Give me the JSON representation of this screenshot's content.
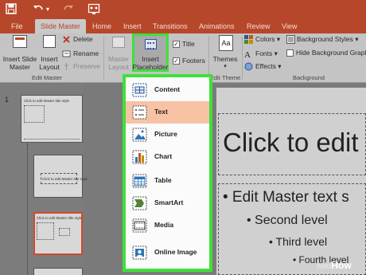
{
  "colors": {
    "accent": "#b7472a",
    "highlight_green": "#3fe03a",
    "menu_hover": "#f8c2a5"
  },
  "quick_access": {
    "save_icon": "save-icon",
    "undo_icon": "undo-icon",
    "redo_icon": "redo-icon",
    "customize_icon": "customize-icon"
  },
  "tabs": [
    "File",
    "Slide Master",
    "Home",
    "Insert",
    "Transitions",
    "Animations",
    "Review",
    "View"
  ],
  "ribbon": {
    "insert_slide_master": "Insert Slide\nMaster",
    "insert_layout": "Insert\nLayout",
    "delete": "Delete",
    "rename": "Rename",
    "preserve": "Preserve",
    "edit_master_group": "Edit Master",
    "master_layout": "Master\nLayout",
    "insert_placeholder": "Insert\nPlaceholder",
    "title_checkbox": "Title",
    "footers_checkbox": "Footers",
    "themes": "Themes",
    "edit_theme_group": "Edit Theme",
    "colors": "Colors",
    "fonts": "Fonts",
    "effects": "Effects",
    "background_styles": "Background Styles",
    "hide_background": "Hide Background Graph",
    "background_group": "Background"
  },
  "slide_panel": {
    "slide_number": "1",
    "thumb1_title": "Click to edit Master title style",
    "thumb2_title": "Click to edit Master title style",
    "thumb3_title": "Click to edit Master title style"
  },
  "slide": {
    "title": "Click to edit",
    "level1": "• Edit Master text s",
    "level2": "• Second level",
    "level3": "• Third level",
    "level4": "• Fourth level"
  },
  "dropdown": {
    "items": [
      {
        "label": "Content",
        "icon": "content-icon"
      },
      {
        "label": "Text",
        "icon": "text-icon"
      },
      {
        "label": "Picture",
        "icon": "picture-icon"
      },
      {
        "label": "Chart",
        "icon": "chart-icon"
      },
      {
        "label": "Table",
        "icon": "table-icon"
      },
      {
        "label": "SmartArt",
        "icon": "smartart-icon"
      },
      {
        "label": "Media",
        "icon": "media-icon"
      },
      {
        "label": "Online Image",
        "icon": "online-image-icon"
      }
    ]
  },
  "watermark": {
    "prefix": "wiki",
    "suffix": "How"
  }
}
